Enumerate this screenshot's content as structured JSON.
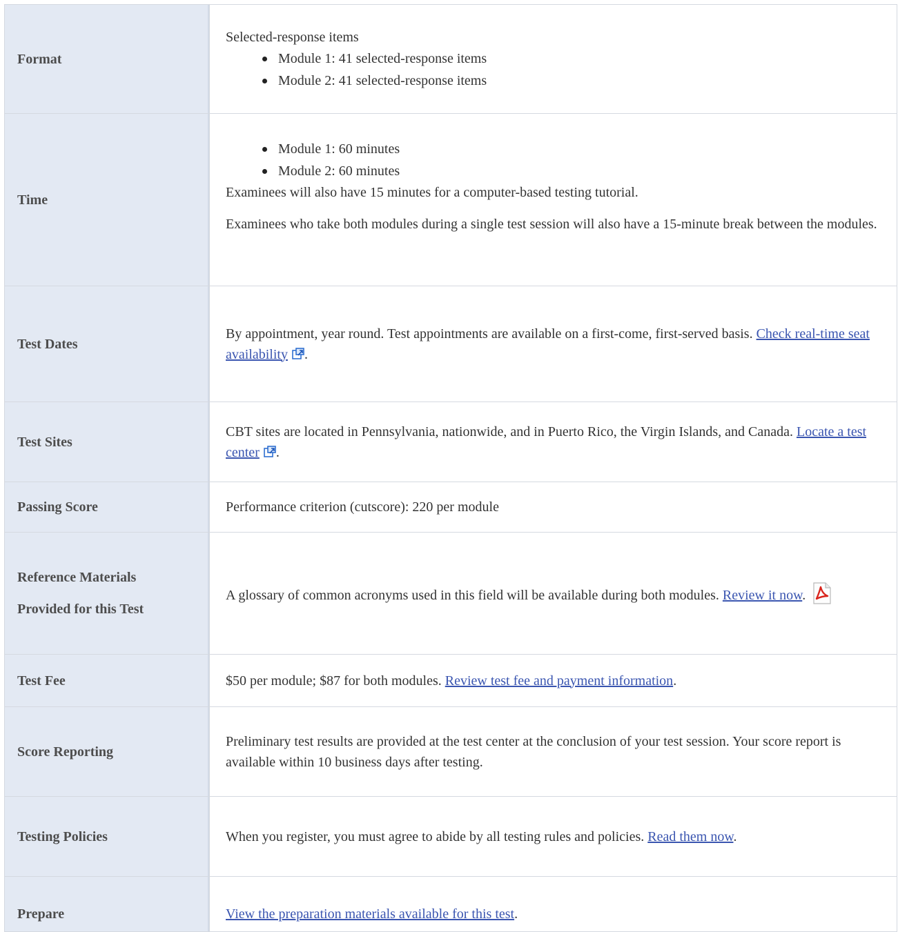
{
  "rows": {
    "format": {
      "label": "Format",
      "intro": "Selected-response items",
      "bullets": [
        "Module 1: 41 selected-response items",
        "Module 2: 41 selected-response items"
      ]
    },
    "time": {
      "label": "Time",
      "bullets": [
        "Module 1: 60 minutes",
        "Module 2: 60 minutes"
      ],
      "p1": "Examinees will also have 15 minutes for a computer-based testing tutorial.",
      "p2": "Examinees who take both modules during a single test session will also have a 15-minute break between the modules."
    },
    "test_dates": {
      "label": "Test Dates",
      "text": "By appointment, year round. Test appointments are available on a first-come, first-served basis.",
      "link": "Check real-time seat availability",
      "suffix": "."
    },
    "test_sites": {
      "label": "Test Sites",
      "text": "CBT sites are located in Pennsylvania, nationwide, and in Puerto Rico, the Virgin Islands, and Canada.",
      "link": "Locate a test center",
      "suffix": "."
    },
    "passing_score": {
      "label": "Passing Score",
      "text": "Performance criterion (cutscore): 220 per module"
    },
    "reference": {
      "label_line1": "Reference Materials",
      "label_line2": "Provided for this Test",
      "text": "A glossary of common acronyms used in this field will be available during both modules.",
      "link": "Review it now",
      "suffix": "."
    },
    "test_fee": {
      "label": "Test Fee",
      "text": "$50 per module; $87 for both modules.",
      "link": "Review test fee and payment information",
      "suffix": "."
    },
    "score_reporting": {
      "label": "Score Reporting",
      "text": "Preliminary test results are provided at the test center at the conclusion of your test session. Your score report is available within 10 business days after testing."
    },
    "testing_policies": {
      "label": "Testing Policies",
      "text": "When you register, you must agree to abide by all testing rules and policies.",
      "link": "Read them now",
      "suffix": "."
    },
    "prepare": {
      "label": "Prepare",
      "link": "View the preparation materials available for this test",
      "suffix": "."
    }
  },
  "icons": {
    "external_link": "external-link-icon",
    "pdf": "pdf-icon"
  },
  "colors": {
    "label_bg": "#e3e9f3",
    "link": "#3a55b0",
    "border": "#d5d9e0"
  }
}
